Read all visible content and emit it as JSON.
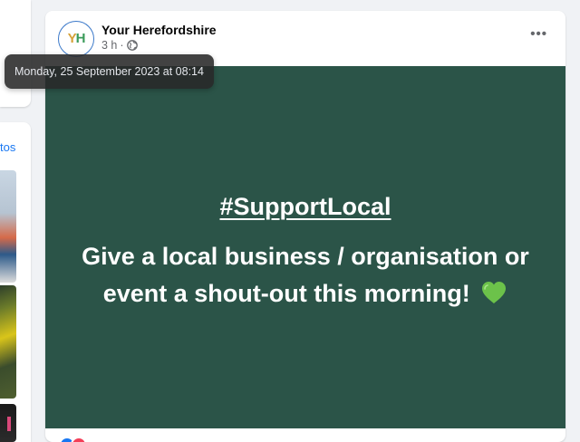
{
  "sidebar": {
    "link_fragment": "tos"
  },
  "post": {
    "page_name": "Your Herefordshire",
    "avatar_text": "YH",
    "time_ago": "3 h",
    "separator": "·",
    "more_icon": "more-horizontal-icon",
    "privacy_icon": "globe-icon",
    "hashtag": "#SupportLocal",
    "message": "Give a local business / organisation or event a shout-out this morning!",
    "emoji": "green-heart",
    "banner_color": "#2b5448",
    "reactions": [
      "like",
      "love"
    ]
  },
  "tooltip": {
    "text": "Monday, 25 September 2023 at 08:14"
  }
}
